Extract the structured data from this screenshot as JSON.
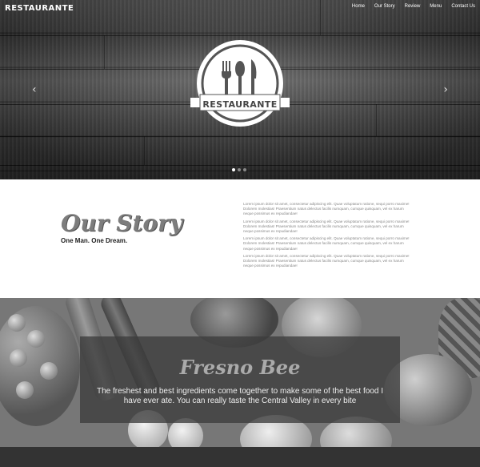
{
  "header": {
    "brand": "RESTAURANTE",
    "nav": [
      "Home",
      "Our Story",
      "Review",
      "Menu",
      "Contact Us"
    ]
  },
  "hero": {
    "logo_text": "RESTAURANTE",
    "prev_icon": "chevron-left-icon",
    "next_icon": "chevron-right-icon",
    "slide_count": 3,
    "active_slide": 1,
    "prev_glyph": "‹",
    "next_glyph": "›"
  },
  "story": {
    "title": "Our Story",
    "subtitle": "One Man. One Dream.",
    "paragraphs": [
      "Lorem ipsum dolor sit amet, consectetur adipiscing elit. Quae voluptatum ratione, sequi porro maxime! Dolorem molestias! Praesentium natus delectus facilis numquam, cumque quisquam, vel ex harum neque possimus ex repudiandae!",
      "Lorem ipsum dolor sit amet, consectetur adipiscing elit. Quae voluptatum ratione, sequi porro maxime! Dolorem molestias! Praesentium natus delectus facilis numquam, cumque quisquam, vel ex harum neque possimus ex repudiandae!",
      "Lorem ipsum dolor sit amet, consectetur adipiscing elit. Quae voluptatum ratione, sequi porro maxime! Dolorem molestias! Praesentium natus delectus facilis numquam, cumque quisquam, vel ex harum neque possimus ex repudiandae!",
      "Lorem ipsum dolor sit amet, consectetur adipiscing elit. Quae voluptatum ratione, sequi porro maxime! Dolorem molestias! Praesentium natus delectus facilis numquam, cumque quisquam, vel ex harum neque possimus ex repudiandae!"
    ]
  },
  "testimonial": {
    "source": "Fresno Bee",
    "quote": "The freshest and best ingredients come together to make some of the best food I have ever ate. You can really taste the Central Valley in every bite"
  },
  "colors": {
    "footer": "#333333",
    "story_bg": "#ffffff"
  }
}
